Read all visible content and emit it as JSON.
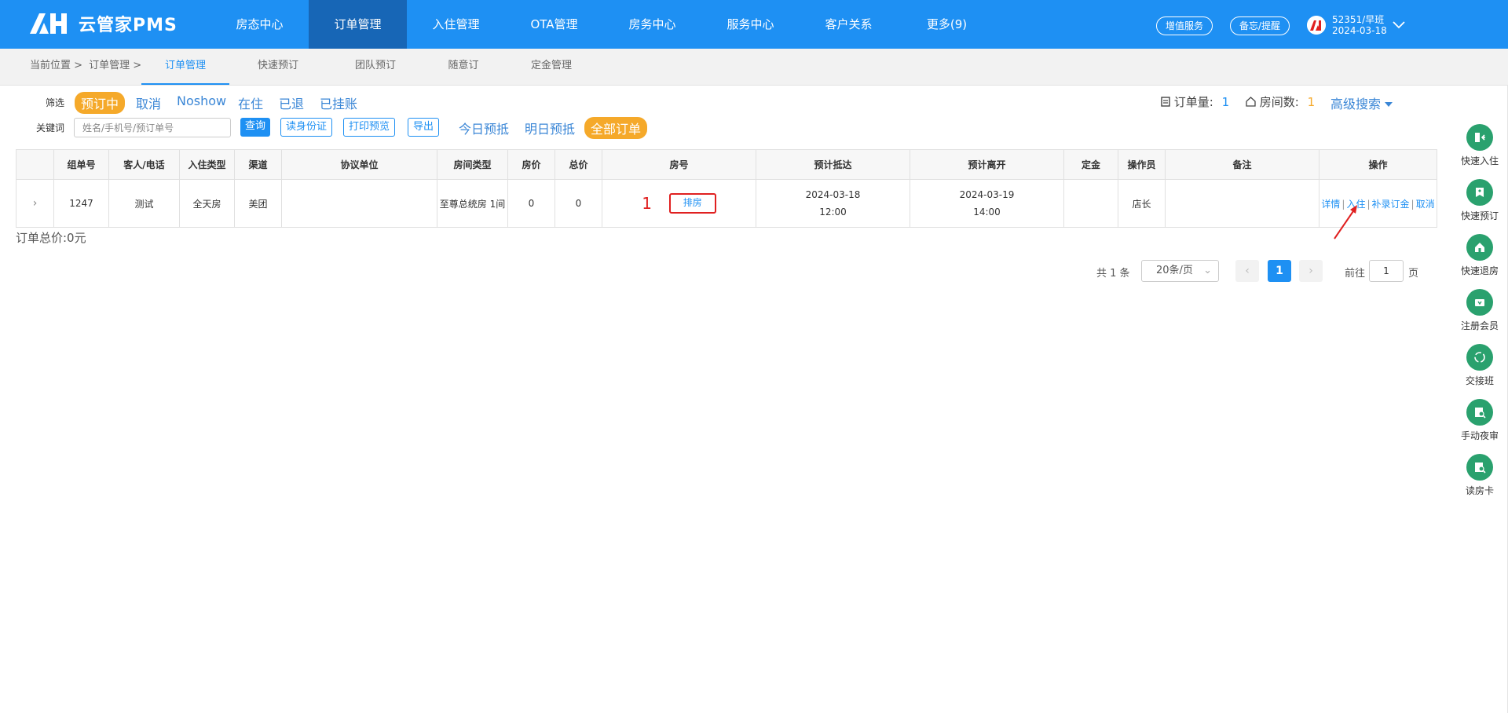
{
  "header": {
    "logo_text": "云管家PMS",
    "nav": [
      "房态中心",
      "订单管理",
      "入住管理",
      "OTA管理",
      "房务中心",
      "服务中心",
      "客户关系",
      "更多(9)"
    ],
    "active_nav": "订单管理",
    "buttons": {
      "value_added": "增值服务",
      "memo": "备忘/提醒"
    },
    "user": {
      "shift": "52351/早班",
      "date": "2024-03-18"
    }
  },
  "breadcrumb": {
    "current_position": "当前位置 >",
    "parent": "订单管理 >"
  },
  "subtabs": [
    "订单管理",
    "快速预订",
    "团队预订",
    "随意订",
    "定金管理"
  ],
  "filters": {
    "label": "筛选",
    "status_chips": [
      "预订中",
      "取消",
      "Noshow",
      "在住",
      "已退",
      "已挂账"
    ],
    "selected_status": "预订中",
    "keyword_label": "关键词",
    "search_placeholder": "姓名/手机号/预订单号",
    "query_button": "查询",
    "action_buttons": [
      "读身份证",
      "打印预览",
      "导出"
    ],
    "date_chips": [
      "今日预抵",
      "明日预抵",
      "全部订单"
    ],
    "selected_date": "全部订单"
  },
  "stats": {
    "order_count_label": "订单量:",
    "order_count": "1",
    "room_count_label": "房间数:",
    "room_count": "1",
    "advanced_search": "高级搜索"
  },
  "table": {
    "headers": [
      "",
      "组单号",
      "客人/电话",
      "入住类型",
      "渠道",
      "协议单位",
      "房间类型",
      "房价",
      "总价",
      "房号",
      "预计抵达",
      "预计离开",
      "定金",
      "操作员",
      "备注",
      "操作"
    ],
    "rows": [
      {
        "expand": "›",
        "group_no": "1247",
        "guest": "测试",
        "stay_type": "全天房",
        "channel": "美团",
        "agreement": "",
        "room_type": "至尊总统房 1间",
        "room_price": "0",
        "total_price": "0",
        "room_annotation": "1",
        "room_button": "排房",
        "arrival_date": "2024-03-18",
        "arrival_time": "12:00",
        "departure_date": "2024-03-19",
        "departure_time": "14:00",
        "deposit": "",
        "operator": "店长",
        "remark": "",
        "actions": [
          "详情",
          "入住",
          "补录订金",
          "取消"
        ]
      }
    ]
  },
  "summary": {
    "total": "订单总价:0元"
  },
  "pagination": {
    "total_text": "共 1 条",
    "page_size": "20条/页",
    "current_page": "1",
    "goto_label": "前往",
    "goto_value": "1",
    "page_suffix": "页"
  },
  "right_toolbar": [
    {
      "label": "快速入住",
      "icon": "check-in-icon"
    },
    {
      "label": "快速预订",
      "icon": "bookmark-icon"
    },
    {
      "label": "快速退房",
      "icon": "home-icon"
    },
    {
      "label": "注册会员",
      "icon": "member-card-icon"
    },
    {
      "label": "交接班",
      "icon": "shift-exchange-icon"
    },
    {
      "label": "手动夜审",
      "icon": "night-audit-icon"
    },
    {
      "label": "读房卡",
      "icon": "room-card-icon"
    }
  ],
  "colors": {
    "header_bg": "#1e90f3",
    "active_nav_bg": "#1766b6",
    "chip_selected": "#f5a92a",
    "link": "#3a86d6",
    "toolbar_icon": "#2aa16e",
    "annotation": "#e02020"
  }
}
